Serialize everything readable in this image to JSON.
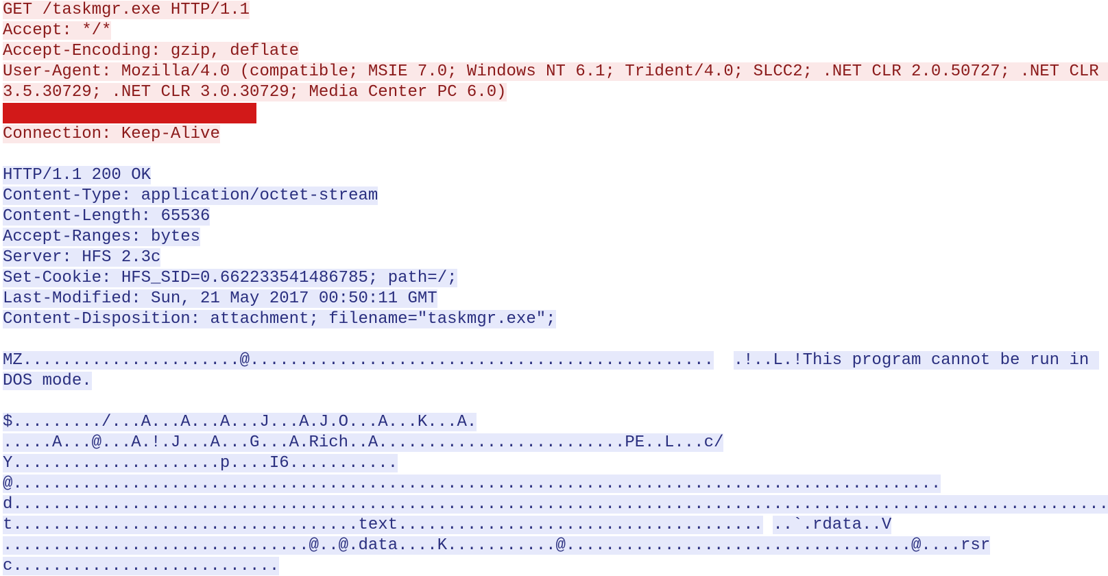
{
  "request": {
    "line": "GET /taskmgr.exe HTTP/1.1",
    "accept": "Accept: */*",
    "accept_encoding": "Accept-Encoding: gzip, deflate",
    "user_agent": "User-Agent: Mozilla/4.0 (compatible; MSIE 7.0; Windows NT 6.1; Trident/4.0; SLCC2; .NET CLR 2.0.50727; .NET CLR 3.5.30729; .NET CLR 3.0.30729; Media Center PC 6.0)",
    "connection": "Connection: Keep-Alive"
  },
  "response": {
    "status": "HTTP/1.1 200 OK",
    "content_type": "Content-Type: application/octet-stream",
    "content_length": "Content-Length: 65536",
    "accept_ranges": "Accept-Ranges: bytes",
    "server": "Server: HFS 2.3c",
    "set_cookie": "Set-Cookie: HFS_SID=0.662233541486785; path=/;",
    "last_modified": "Last-Modified: Sun, 21 May 2017 00:50:11 GMT",
    "content_disposition": "Content-Disposition: attachment; filename=\"taskmgr.exe\";"
  },
  "body": {
    "l1a": "MZ......................@...............................................",
    "gap1": "  ",
    "l1b": ".!..L.!This program cannot be run in DOS mode.",
    "l3": "$........./...A...A...A...J...A.J.O...A...K...A.",
    "l4": ".....A...@...A.!.J...A...G...A.Rich..A.........................PE..L...c/",
    "l5": "Y.....................p....I6...........@..............................................................................................d...................................................................................................................t...................................text.....................................",
    "gap2": " ",
    "l5b": "..`.rdata..V",
    "l6": "...............................@..@.data....K...........@...................................@....rsrc..........................."
  }
}
